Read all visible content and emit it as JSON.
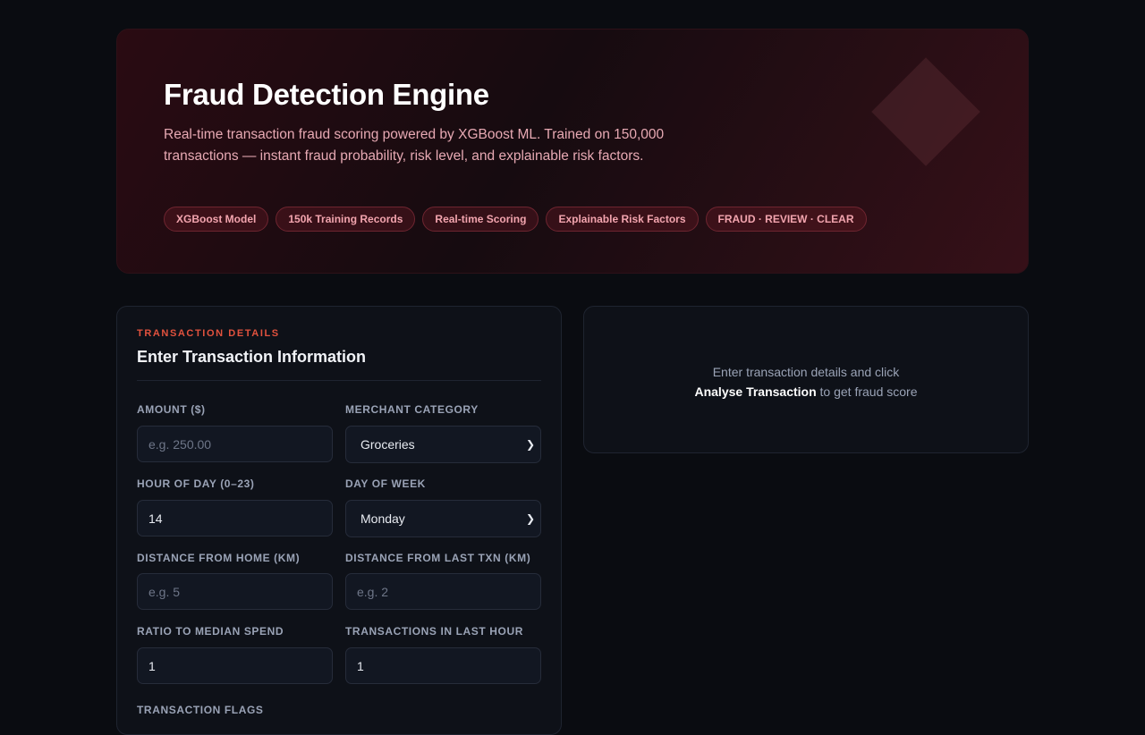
{
  "hero": {
    "title": "Fraud Detection Engine",
    "description": "Real-time transaction fraud scoring powered by XGBoost ML. Trained on 150,000 transactions — instant fraud probability, risk level, and explainable risk factors.",
    "tags": [
      "XGBoost Model",
      "150k Training Records",
      "Real-time Scoring",
      "Explainable Risk Factors",
      "FRAUD · REVIEW · CLEAR"
    ]
  },
  "form": {
    "kicker": "TRANSACTION DETAILS",
    "title": "Enter Transaction Information",
    "amount": {
      "label": "AMOUNT ($)",
      "placeholder": "e.g. 250.00",
      "value": ""
    },
    "merchant_category": {
      "label": "MERCHANT CATEGORY",
      "selected": "Groceries"
    },
    "hour_of_day": {
      "label": "HOUR OF DAY (0–23)",
      "value": "14"
    },
    "day_of_week": {
      "label": "DAY OF WEEK",
      "selected": "Monday"
    },
    "distance_home": {
      "label": "DISTANCE FROM HOME (KM)",
      "placeholder": "e.g. 5",
      "value": ""
    },
    "distance_last": {
      "label": "DISTANCE FROM LAST TXN (KM)",
      "placeholder": "e.g. 2",
      "value": ""
    },
    "ratio_median": {
      "label": "RATIO TO MEDIAN SPEND",
      "value": "1"
    },
    "txn_last_hour": {
      "label": "TRANSACTIONS IN LAST HOUR",
      "value": "1"
    },
    "flags_label": "TRANSACTION FLAGS"
  },
  "result": {
    "line1": "Enter transaction details and click",
    "action": "Analyse Transaction",
    "line2_suffix": " to get fraud score"
  },
  "colors": {
    "background": "#0a0c11",
    "accent": "#e2523e",
    "tag_text": "#f2a4ae",
    "hero_text": "#e7a9b3"
  }
}
